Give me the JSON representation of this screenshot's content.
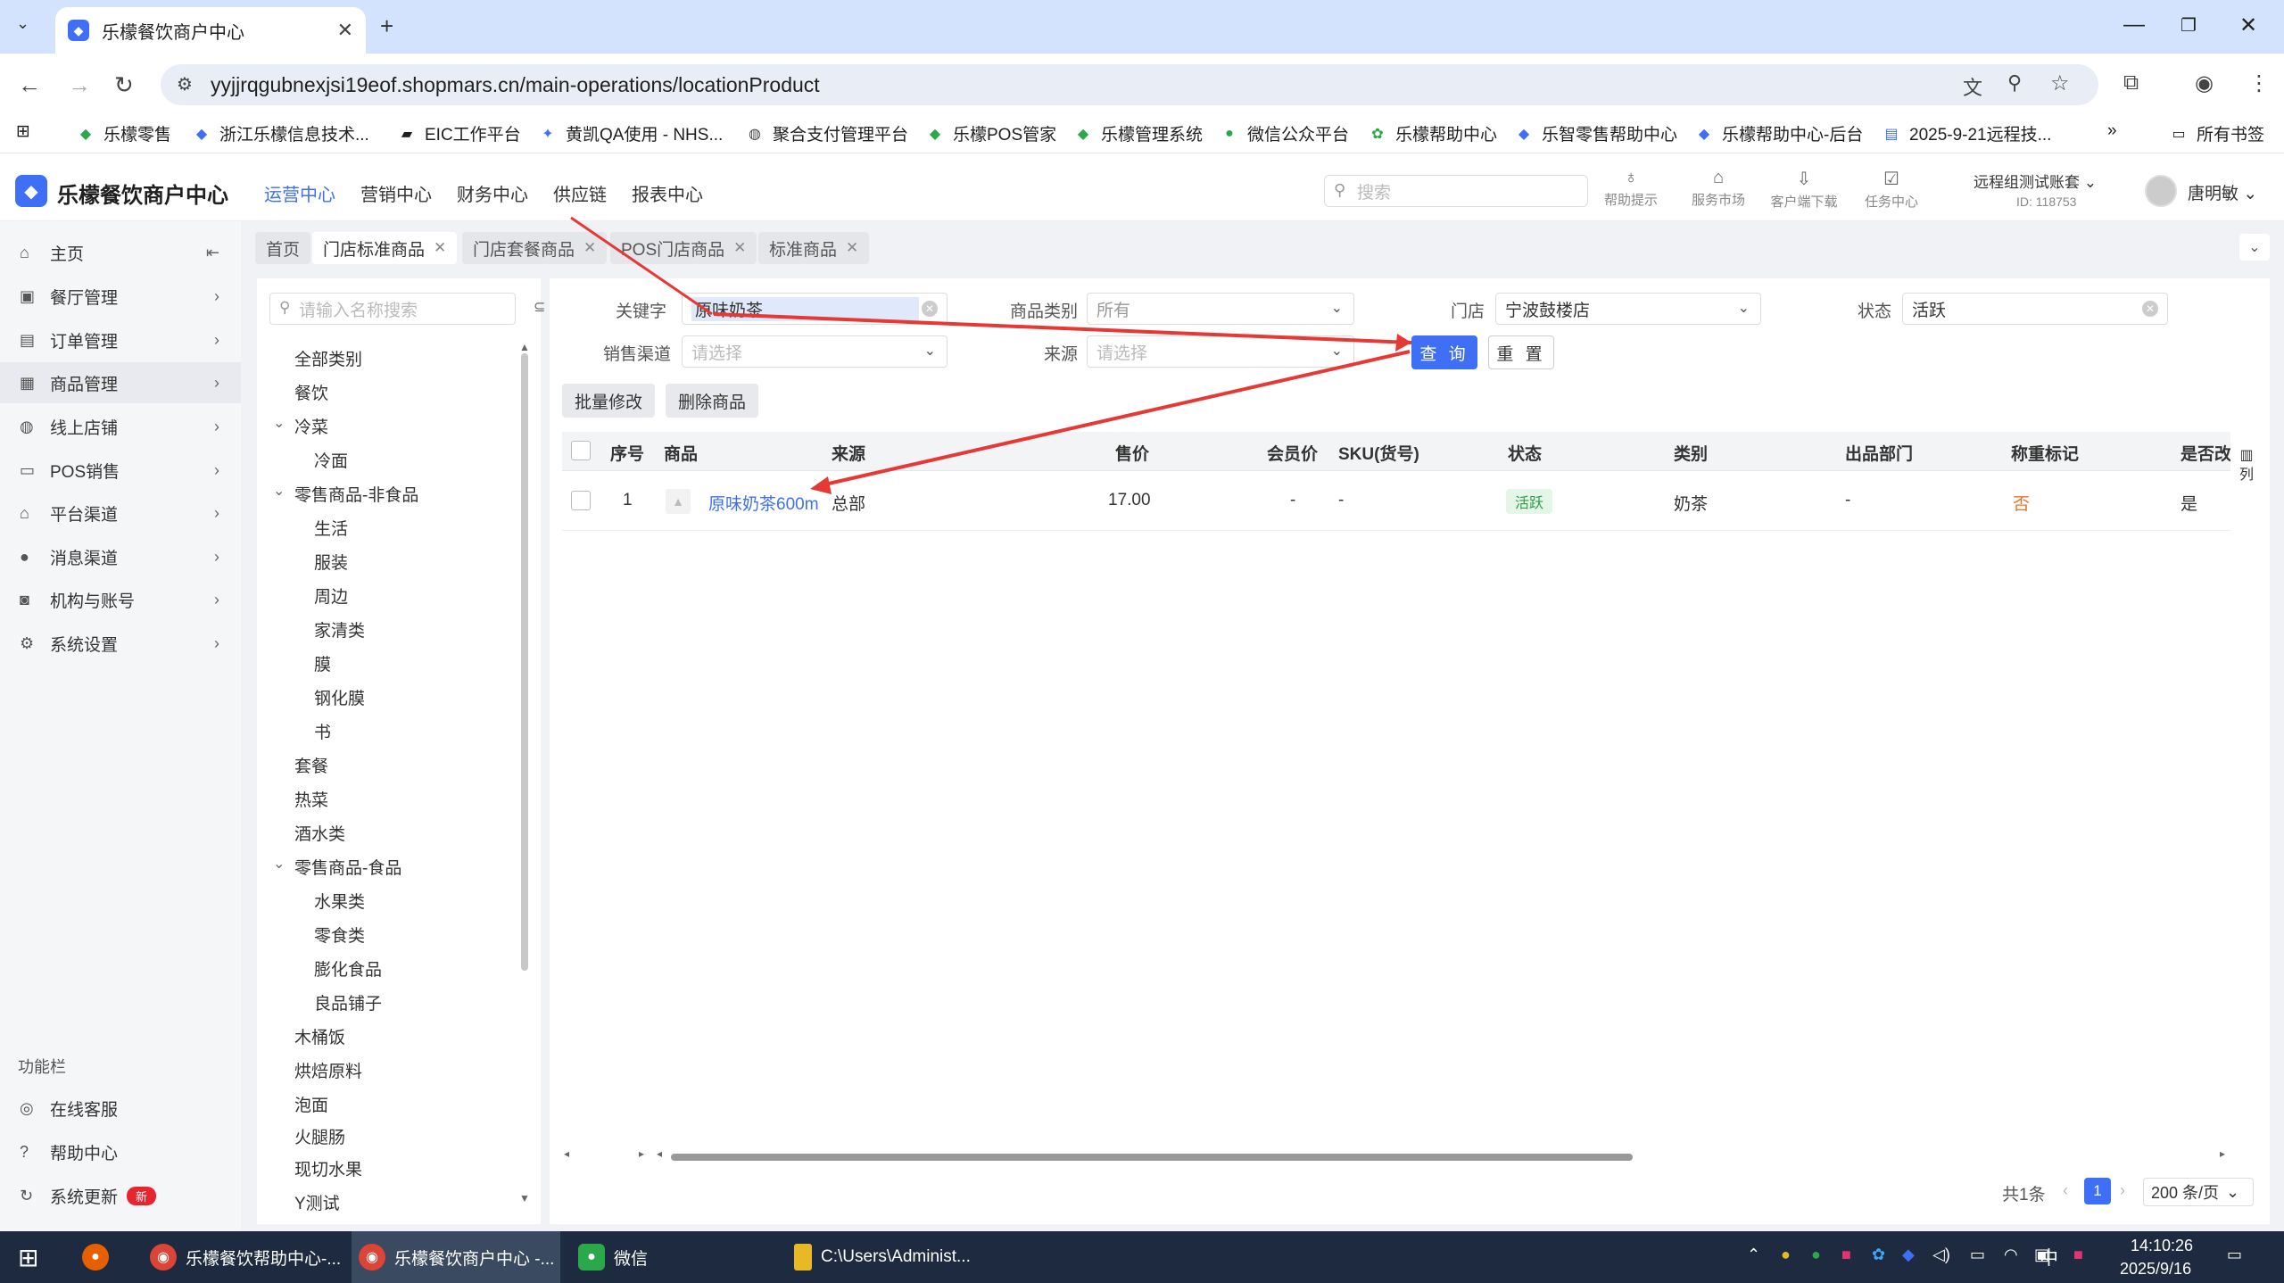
{
  "browser": {
    "tab_title": "乐檬餐饮商户中心",
    "url": "yyjjrqgubnexjsi19eof.shopmars.cn/main-operations/locationProduct",
    "bookmarks": [
      "乐檬零售",
      "浙江乐檬信息技术...",
      "EIC工作平台",
      "黄凯QA使用 - NHS...",
      "聚合支付管理平台",
      "乐檬POS管家",
      "乐檬管理系统",
      "微信公众平台",
      "乐檬帮助中心",
      "乐智零售帮助中心",
      "乐檬帮助中心-后台",
      "2025-9-21远程技..."
    ],
    "all_bookmarks": "所有书签"
  },
  "header": {
    "logo": "乐檬餐饮商户中心",
    "nav": [
      "运营中心",
      "营销中心",
      "财务中心",
      "供应链",
      "报表中心"
    ],
    "search_placeholder": "搜索",
    "tools": [
      "帮助提示",
      "服务市场",
      "客户端下载",
      "任务中心"
    ],
    "account": "远程组测试账套",
    "account_id": "ID: 118753",
    "user": "唐明敏"
  },
  "sidebar": {
    "items": [
      "主页",
      "餐厅管理",
      "订单管理",
      "商品管理",
      "线上店铺",
      "POS销售",
      "平台渠道",
      "消息渠道",
      "机构与账号",
      "系统设置"
    ],
    "func_title": "功能栏",
    "func_items": [
      "在线客服",
      "帮助中心",
      "系统更新"
    ],
    "new_badge": "新"
  },
  "page_tabs": [
    "首页",
    "门店标准商品",
    "门店套餐商品",
    "POS门店商品",
    "标准商品"
  ],
  "tree": {
    "search_placeholder": "请输入名称搜索",
    "items": [
      "全部类别",
      "餐饮",
      "冷菜",
      "冷面",
      "零售商品-非食品",
      "生活",
      "服装",
      "周边",
      "家清类",
      "膜",
      "钢化膜",
      "书",
      "套餐",
      "热菜",
      "酒水类",
      "零售商品-食品",
      "水果类",
      "零食类",
      "膨化食品",
      "良品铺子",
      "木桶饭",
      "烘焙原料",
      "泡面",
      "火腿肠",
      "现切水果",
      "Y测试"
    ]
  },
  "filters": {
    "keyword_label": "关键字",
    "keyword_value": "原味奶茶",
    "category_label": "商品类别",
    "category_value": "所有",
    "store_label": "门店",
    "store_value": "宁波鼓楼店",
    "status_label": "状态",
    "status_value": "活跃",
    "channel_label": "销售渠道",
    "channel_placeholder": "请选择",
    "source_label": "来源",
    "source_placeholder": "请选择",
    "query_btn": "查 询",
    "reset_btn": "重 置"
  },
  "actions": [
    "批量修改",
    "删除商品"
  ],
  "table": {
    "columns": [
      "序号",
      "商品",
      "来源",
      "售价",
      "会员价",
      "SKU(货号)",
      "状态",
      "类别",
      "出品部门",
      "称重标记",
      "是否改"
    ],
    "col_settings": "列",
    "rows": [
      {
        "index": "1",
        "product": "原味奶茶600m",
        "source": "总部",
        "price": "17.00",
        "member_price": "-",
        "sku": "-",
        "status": "活跃",
        "category": "奶茶",
        "dept": "-",
        "weigh": "否",
        "changed": "是"
      }
    ]
  },
  "pager": {
    "total": "共1条",
    "page": "1",
    "size": "200 条/页"
  },
  "taskbar": {
    "apps": [
      "乐檬餐饮帮助中心-...",
      "乐檬餐饮商户中心 -...",
      "微信",
      "C:\\Users\\Administ..."
    ],
    "ime": "中",
    "time": "14:10:26",
    "date": "2025/9/16"
  },
  "colors": {
    "accent": "#3f6ff5",
    "annotation": "#e53935",
    "status_green": "#2d9b4a",
    "weigh_no": "#e8742a"
  }
}
